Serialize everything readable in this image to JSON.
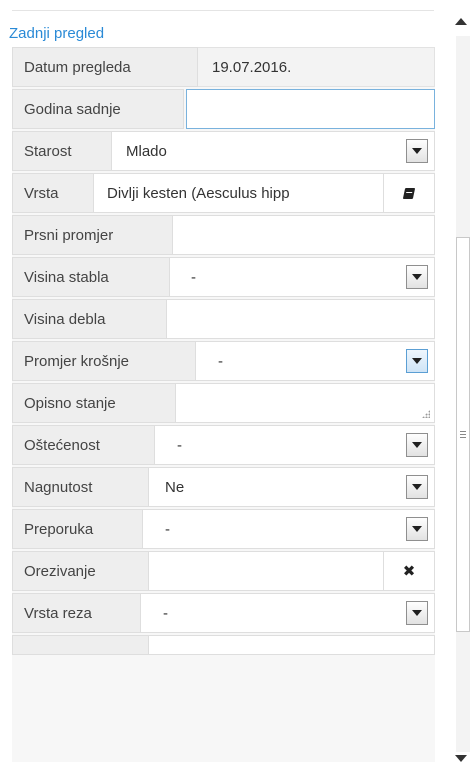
{
  "section": {
    "title": "Zadnji pregled"
  },
  "fields": {
    "datum_pregleda": {
      "label": "Datum pregleda",
      "value": "19.07.2016."
    },
    "godina_sadnje": {
      "label": "Godina sadnje",
      "value": ""
    },
    "starost": {
      "label": "Starost",
      "value": "Mlado"
    },
    "vrsta": {
      "label": "Vrsta",
      "value": "Divlji kesten (Aesculus hipp"
    },
    "prsni_promjer": {
      "label": "Prsni promjer",
      "value": ""
    },
    "visina_stabla": {
      "label": "Visina stabla",
      "value": "-"
    },
    "visina_debla": {
      "label": "Visina debla",
      "value": ""
    },
    "promjer_krosnje": {
      "label": "Promjer krošnje",
      "value": "-"
    },
    "opisno_stanje": {
      "label": "Opisno stanje",
      "value": ""
    },
    "ostecenost": {
      "label": "Oštećenost",
      "value": "-"
    },
    "nagnutost": {
      "label": "Nagnutost",
      "value": "Ne"
    },
    "preporuka": {
      "label": "Preporuka",
      "value": "-"
    },
    "orezivanje": {
      "label": "Orezivanje",
      "value": "",
      "clear_glyph": "✖"
    },
    "vrsta_reza": {
      "label": "Vrsta reza",
      "value": "-"
    }
  },
  "icons": {
    "dropdown": "chevron-down-icon",
    "lookup": "book-icon",
    "clear": "close-icon",
    "resize": "resize-grip-icon"
  },
  "colors": {
    "section_title": "#2a8ad6",
    "label_bg": "#eeeeee",
    "focus_border": "#79b2dd"
  }
}
